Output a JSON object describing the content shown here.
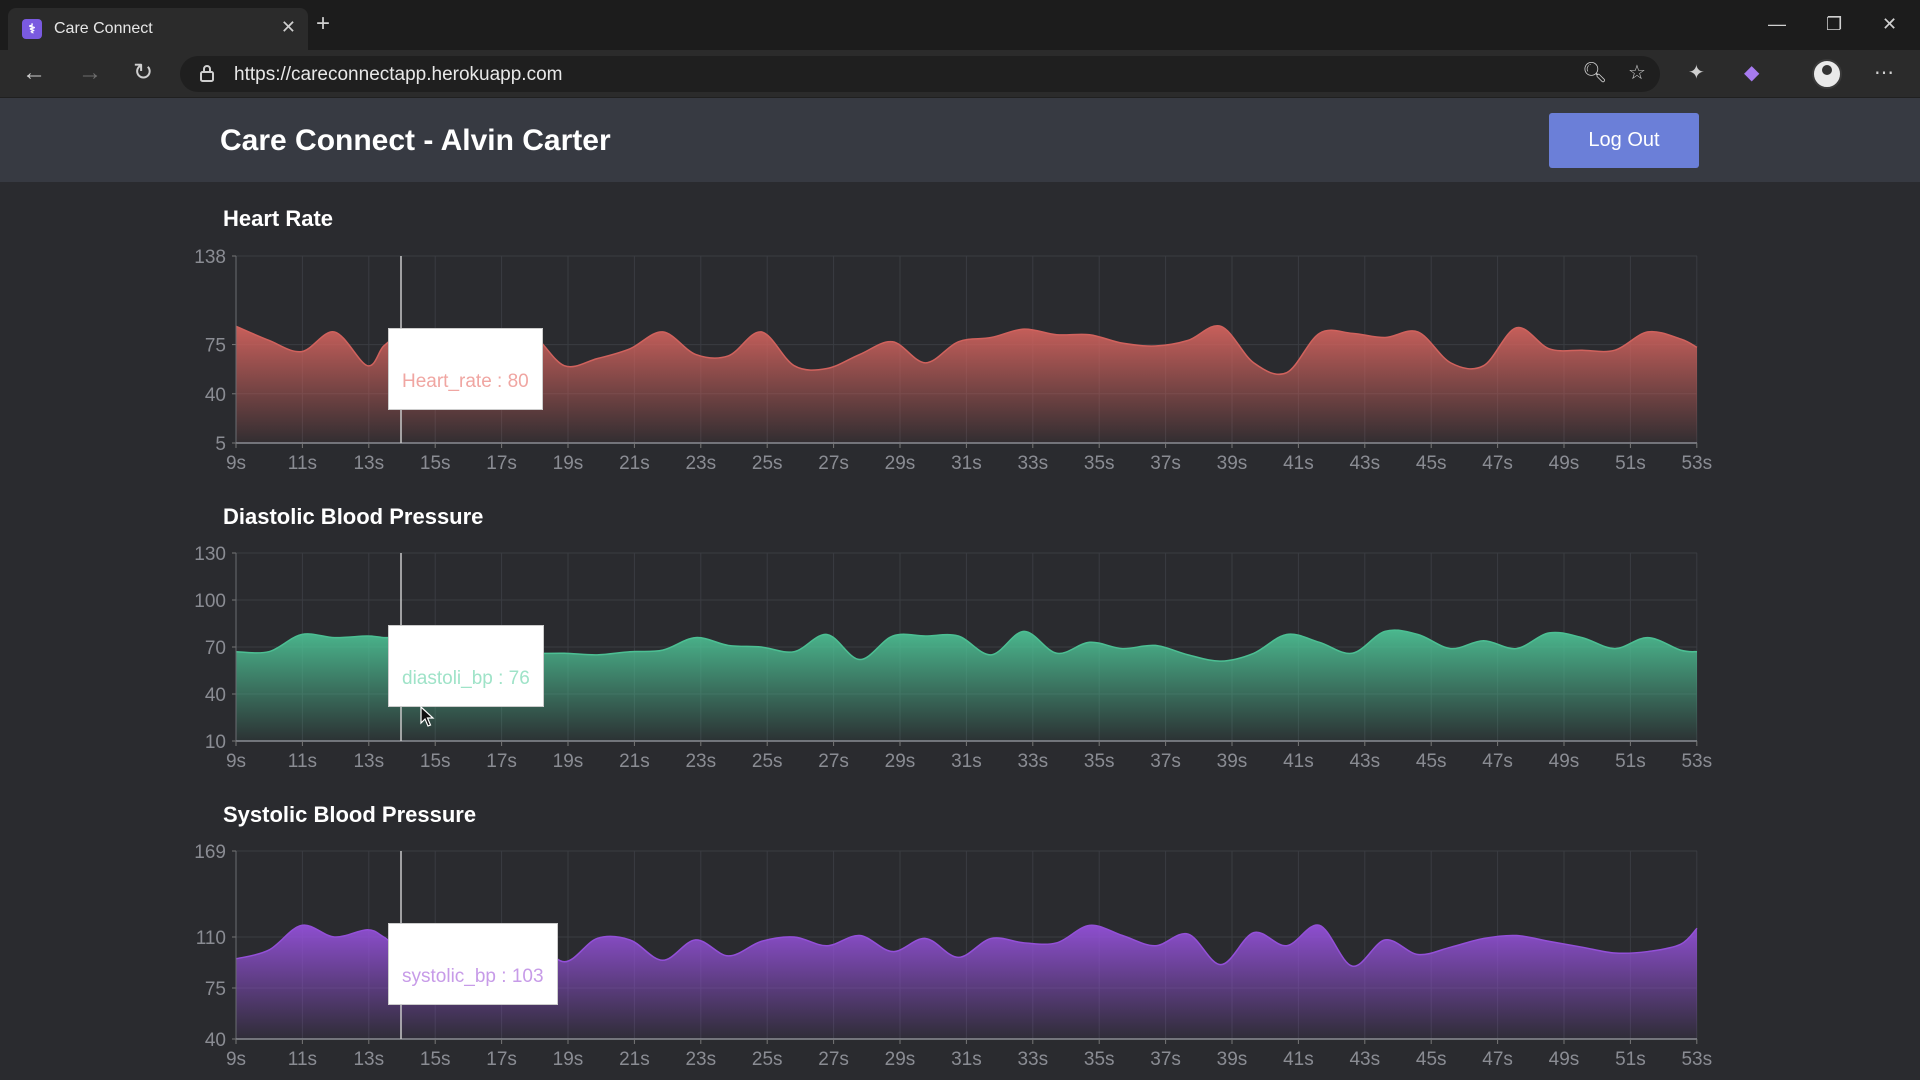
{
  "browser": {
    "tab_title": "Care Connect",
    "favicon_glyph": "⚕",
    "url": "https://careconnectapp.herokuapp.com"
  },
  "app": {
    "title": "Care Connect - Alvin Carter",
    "logout_label": "Log Out"
  },
  "x_ticks": [
    "9s",
    "11s",
    "13s",
    "15s",
    "17s",
    "19s",
    "21s",
    "23s",
    "25s",
    "27s",
    "29s",
    "31s",
    "33s",
    "35s",
    "37s",
    "39s",
    "41s",
    "43s",
    "45s",
    "47s",
    "49s",
    "51s",
    "53s"
  ],
  "charts": [
    {
      "title": "Heart Rate",
      "color": "#d0625d",
      "y_ticks": [
        5,
        40,
        75,
        138
      ],
      "ylim": [
        5,
        138
      ],
      "tooltip": {
        "label": "Heart_rate : 80",
        "color": "#f0a6a2"
      },
      "cursor_time": 14
    },
    {
      "title": "Diastolic Blood Pressure",
      "color": "#4cbf93",
      "y_ticks": [
        10,
        40,
        70,
        100,
        130
      ],
      "ylim": [
        10,
        130
      ],
      "tooltip": {
        "label": "diastoli_bp : 76",
        "color": "#9fe3c8"
      },
      "cursor_time": 14
    },
    {
      "title": "Systolic Blood Pressure",
      "color": "#9350d8",
      "y_ticks": [
        40,
        75,
        110,
        169
      ],
      "ylim": [
        40,
        169
      ],
      "tooltip": {
        "label": "systolic_bp : 103",
        "color": "#c79be8"
      },
      "cursor_time": 14
    }
  ],
  "chart_data": [
    {
      "type": "area",
      "title": "Heart Rate",
      "xlabel": "",
      "ylabel": "",
      "ylim": [
        5,
        138
      ],
      "series": [
        {
          "name": "Heart_rate",
          "x": [
            9,
            10,
            11,
            12,
            13,
            13.5,
            14,
            15,
            16,
            17,
            18,
            19,
            20,
            21,
            22,
            23,
            24,
            25,
            26,
            27,
            28,
            29,
            30,
            31,
            32,
            33,
            34,
            35,
            36,
            37,
            38,
            39,
            40,
            41,
            42,
            43,
            44,
            45,
            46,
            47,
            48,
            49,
            50,
            51,
            52,
            53,
            53.5
          ],
          "values": [
            88,
            78,
            70,
            84,
            60,
            74,
            80,
            76,
            74,
            78,
            82,
            60,
            65,
            72,
            84,
            68,
            67,
            84,
            60,
            58,
            68,
            77,
            62,
            77,
            80,
            86,
            82,
            82,
            76,
            74,
            78,
            88,
            62,
            55,
            83,
            83,
            80,
            84,
            62,
            60,
            87,
            72,
            71,
            71,
            84,
            79,
            73
          ]
        }
      ]
    },
    {
      "type": "area",
      "title": "Diastolic Blood Pressure",
      "xlabel": "",
      "ylabel": "",
      "ylim": [
        10,
        130
      ],
      "series": [
        {
          "name": "diastoli_bp",
          "x": [
            9,
            10,
            11,
            12,
            13,
            13.5,
            14,
            15,
            16,
            17,
            18,
            19,
            20,
            21,
            22,
            23,
            24,
            25,
            26,
            27,
            28,
            29,
            30,
            31,
            32,
            33,
            34,
            35,
            36,
            37,
            38,
            39,
            40,
            41,
            42,
            43,
            44,
            45,
            46,
            47,
            48,
            49,
            50,
            51,
            52,
            53,
            53.5
          ],
          "values": [
            67,
            67,
            78,
            76,
            77,
            76,
            76,
            73,
            70,
            68,
            66,
            66,
            65,
            67,
            68,
            76,
            71,
            70,
            67,
            78,
            62,
            77,
            77,
            77,
            65,
            80,
            66,
            73,
            69,
            71,
            65,
            61,
            66,
            78,
            73,
            66,
            80,
            78,
            69,
            74,
            69,
            79,
            76,
            69,
            76,
            68,
            67
          ]
        }
      ]
    },
    {
      "type": "area",
      "title": "Systolic Blood Pressure",
      "xlabel": "",
      "ylabel": "",
      "ylim": [
        40,
        169
      ],
      "series": [
        {
          "name": "systolic_bp",
          "x": [
            9,
            10,
            11,
            12,
            13,
            13.5,
            14,
            15,
            16,
            17,
            18,
            19,
            20,
            21,
            22,
            23,
            24,
            25,
            26,
            27,
            28,
            29,
            30,
            31,
            32,
            33,
            34,
            35,
            36,
            37,
            38,
            39,
            40,
            41,
            42,
            43,
            44,
            45,
            46,
            47,
            48,
            49,
            50,
            51,
            52,
            53,
            53.5
          ],
          "values": [
            95,
            101,
            118,
            110,
            115,
            110,
            103,
            102,
            104,
            106,
            110,
            93,
            109,
            108,
            94,
            108,
            97,
            107,
            110,
            104,
            111,
            100,
            109,
            96,
            109,
            106,
            106,
            118,
            111,
            104,
            112,
            91,
            113,
            104,
            118,
            90,
            108,
            98,
            103,
            109,
            111,
            107,
            103,
            99,
            100,
            105,
            116
          ]
        }
      ]
    }
  ]
}
